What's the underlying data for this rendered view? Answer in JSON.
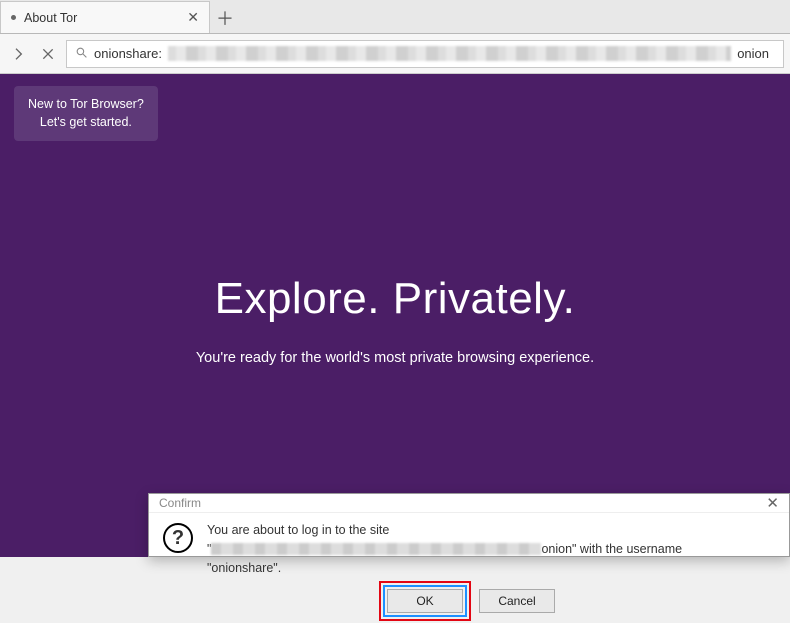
{
  "tab": {
    "title": "About Tor"
  },
  "url": {
    "prefix": "onionshare:",
    "suffix": "onion"
  },
  "tooltip": {
    "line1": "New to Tor Browser?",
    "line2": "Let's get started."
  },
  "hero": {
    "title": "Explore. Privately.",
    "subtitle": "You're ready for the world's most private browsing experience."
  },
  "dialog": {
    "title": "Confirm",
    "line1": "You are about to log in to the site",
    "line2_suffix": "onion\" with the username",
    "line3": "\"onionshare\".",
    "ok": "OK",
    "cancel": "Cancel"
  }
}
